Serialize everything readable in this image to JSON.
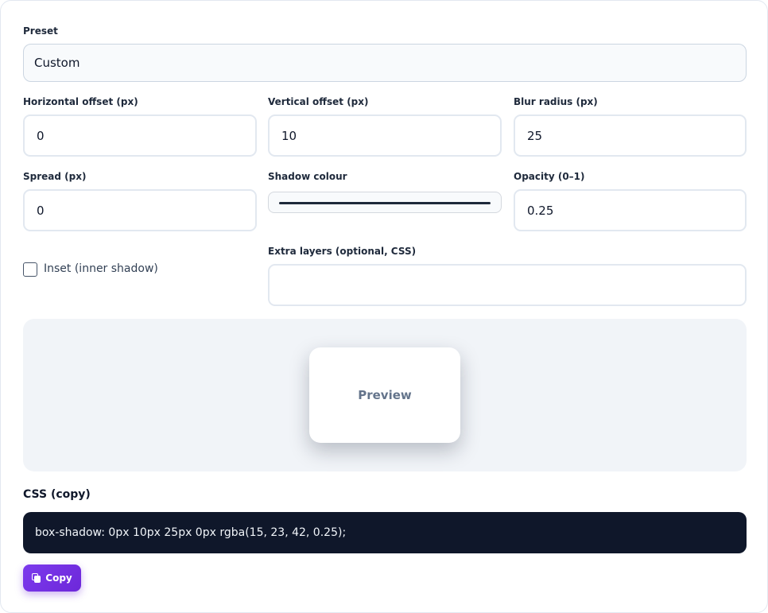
{
  "preset": {
    "label": "Preset",
    "value": "Custom"
  },
  "horizontal_offset": {
    "label": "Horizontal offset (px)",
    "value": "0"
  },
  "vertical_offset": {
    "label": "Vertical offset (px)",
    "value": "10"
  },
  "blur_radius": {
    "label": "Blur radius (px)",
    "value": "25"
  },
  "spread": {
    "label": "Spread (px)",
    "value": "0"
  },
  "shadow_colour": {
    "label": "Shadow colour",
    "value": "#0f172a"
  },
  "opacity": {
    "label": "Opacity (0–1)",
    "value": "0.25"
  },
  "inset": {
    "label": "Inset (inner shadow)",
    "checked": false
  },
  "extra_layers": {
    "label": "Extra layers (optional, CSS)",
    "value": ""
  },
  "preview": {
    "label": "Preview"
  },
  "css_output": {
    "title": "CSS (copy)",
    "code": "box-shadow: 0px 10px 25px 0px rgba(15, 23, 42, 0.25);"
  },
  "copy_button": {
    "label": "Copy",
    "icon": "copy-icon"
  },
  "colors": {
    "accent": "#6d28d9",
    "code_bg": "#0f172a",
    "preview_bg": "#f1f4f8"
  }
}
